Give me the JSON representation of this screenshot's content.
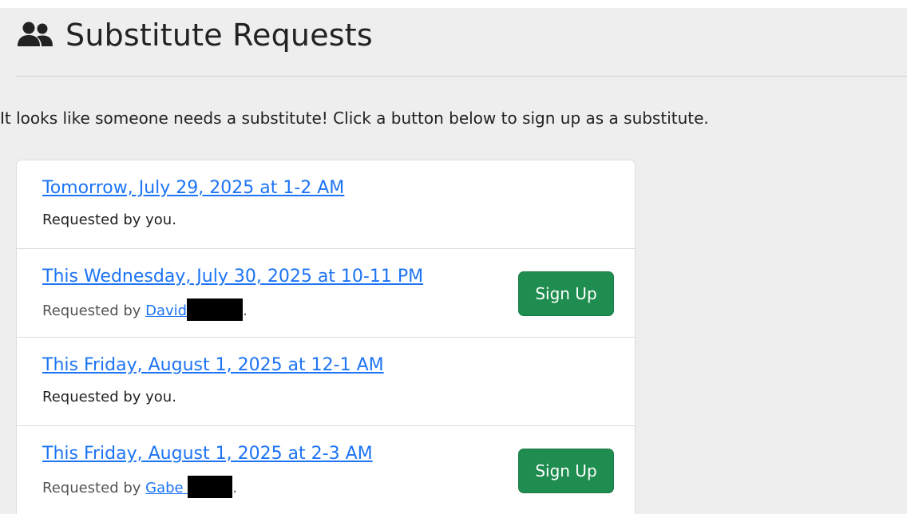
{
  "header": {
    "icon": "users-icon",
    "title": "Substitute Requests"
  },
  "intro": "It looks like someone needs a substitute! Click a button below to sign up as a substitute.",
  "requests": [
    {
      "date": "Tomorrow, July 29, 2025 at 1-2 AM",
      "requested_prefix": "Requested by you.",
      "has_signup": false
    },
    {
      "date": "This Wednesday, July 30, 2025 at 10-11 PM",
      "requested_prefix": "Requested by ",
      "requester": "David",
      "requested_suffix": ".",
      "signup_label": "Sign Up",
      "has_signup": true
    },
    {
      "date": "This Friday, August 1, 2025 at 12-1 AM",
      "requested_prefix": "Requested by you.",
      "has_signup": false
    },
    {
      "date": "This Friday, August 1, 2025 at 2-3 AM",
      "requested_prefix": "Requested by ",
      "requester": "Gabe",
      "requested_suffix": ".",
      "signup_label": "Sign Up",
      "has_signup": true
    }
  ],
  "colors": {
    "link": "#1d74f5",
    "button": "#1f8d4f",
    "background": "#eeeeee"
  }
}
